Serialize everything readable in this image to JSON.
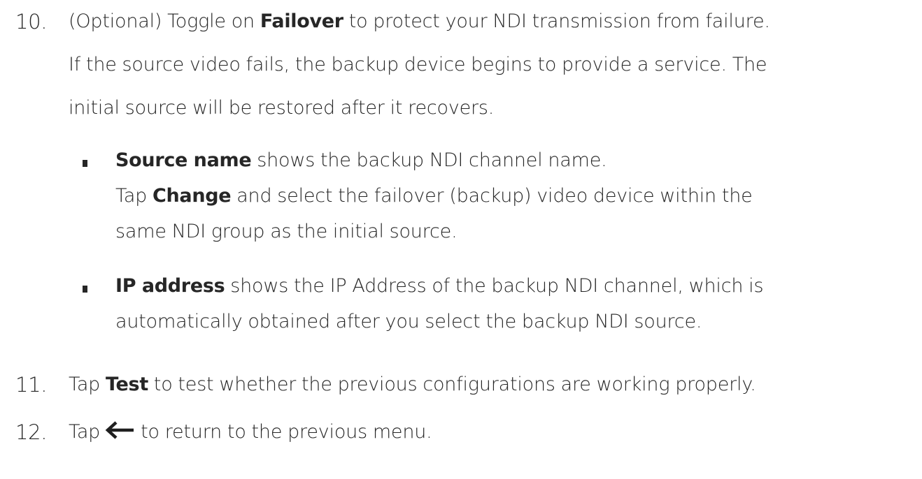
{
  "steps": [
    {
      "number": "10.",
      "lines": [
        [
          "(Optional) Toggle on ",
          "Failover",
          " to protect your NDI transmission from failure."
        ],
        [
          "If the source video fails, the backup device begins to provide a service. The"
        ],
        [
          "initial source will be restored after it recovers."
        ]
      ],
      "bullets": [
        {
          "lines": [
            [
              "Source name",
              " shows the backup NDI channel name."
            ],
            [
              "Tap ",
              "Change",
              " and select the failover (backup) video device within the"
            ],
            [
              "same NDI group as the initial source."
            ]
          ]
        },
        {
          "lines": [
            [
              "IP address",
              " shows the IP Address of the backup NDI channel, which is"
            ],
            [
              "automatically obtained after you select the backup NDI source."
            ]
          ]
        }
      ]
    },
    {
      "number": "11.",
      "lines": [
        [
          "Tap ",
          "Test",
          " to test whether the previous configurations are working properly."
        ]
      ]
    },
    {
      "number": "12.",
      "line": {
        "before": "Tap",
        "icon": "back-arrow-icon",
        "after": "to return to the previous menu."
      }
    }
  ]
}
